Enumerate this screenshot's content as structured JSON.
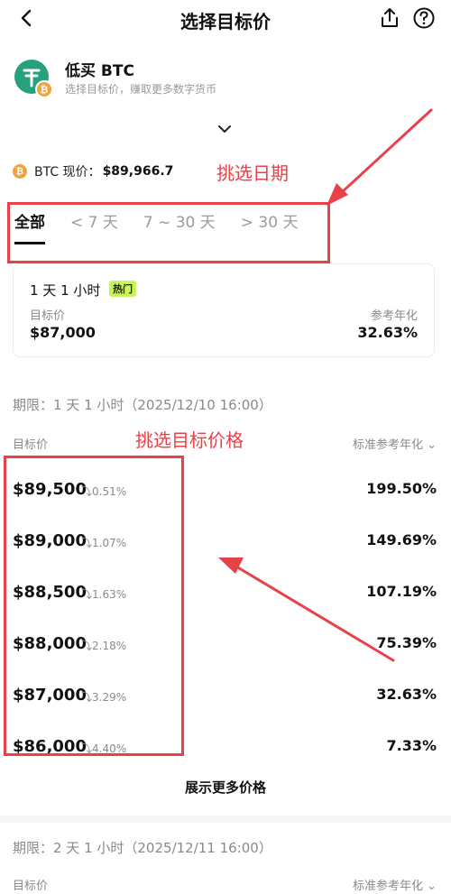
{
  "header": {
    "title": "选择目标价",
    "back_icon": "back-chevron-icon",
    "share_icon": "share-icon",
    "help_icon": "help-icon"
  },
  "product": {
    "name": "低买 BTC",
    "description": "选择目标价，赚取更多数字货币",
    "logo_icon": "usdt-btc-logo-icon"
  },
  "current_price": {
    "label": "BTC 现价：",
    "value": "$89,966.7",
    "coin_symbol": "₿"
  },
  "tabs": [
    {
      "label": "全部",
      "active": true
    },
    {
      "label": "< 7 天"
    },
    {
      "label": "7 ~ 30 天"
    },
    {
      "label": "> 30 天"
    }
  ],
  "annotations": {
    "date": "挑选日期",
    "price": "挑选目标价格",
    "color": "#e8414a"
  },
  "featured": {
    "period": "1 天 1 小时",
    "hot_badge": "热门",
    "target_label": "目标价",
    "target_value": "$87,000",
    "apr_label": "参考年化",
    "apr_value": "32.63%"
  },
  "section1": {
    "period": "期限：1 天 1 小时（2025/12/10 16:00）",
    "col_left": "目标价",
    "col_right": "标准参考年化 ⌄"
  },
  "rows": [
    {
      "price": "$89,500",
      "change": "⤵0.51%",
      "apr": "199.50%"
    },
    {
      "price": "$89,000",
      "change": "⤵1.07%",
      "apr": "149.69%"
    },
    {
      "price": "$88,500",
      "change": "⤵1.63%",
      "apr": "107.19%"
    },
    {
      "price": "$88,000",
      "change": "⤵2.18%",
      "apr": "75.39%"
    },
    {
      "price": "$87,000",
      "change": "⤵3.29%",
      "apr": "32.63%"
    },
    {
      "price": "$86,000",
      "change": "⤵4.40%",
      "apr": "7.33%"
    }
  ],
  "show_more": "展示更多价格",
  "section2": {
    "period": "期限：2 天 1 小时（2025/12/11 16:00）",
    "col_left": "目标价",
    "col_right": "标准参考年化 ⌄"
  },
  "colors": {
    "accent": "#e8414a",
    "hot": "#c9f35a",
    "btc": "#f2a33a",
    "usdt": "#26a17b"
  }
}
